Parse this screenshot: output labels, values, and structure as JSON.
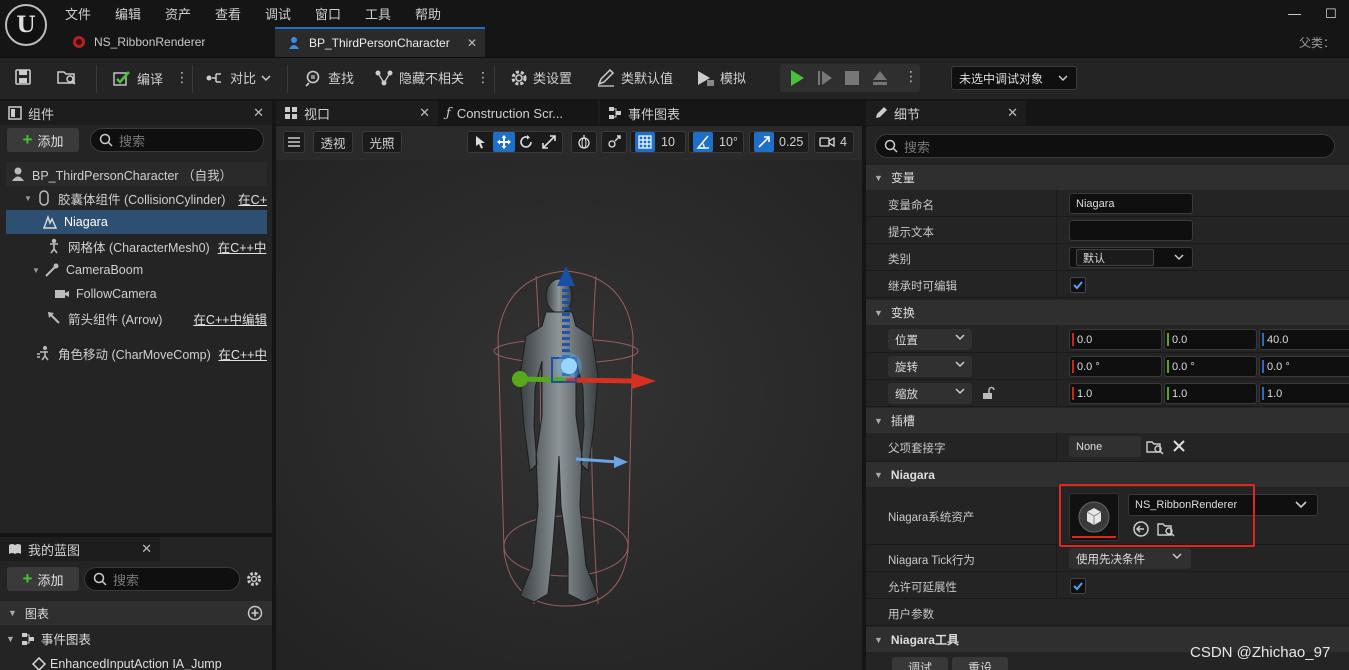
{
  "menu": [
    "文件",
    "编辑",
    "资产",
    "查看",
    "调试",
    "窗口",
    "工具",
    "帮助"
  ],
  "window_controls": {
    "minimize": "—",
    "maximize": "☐"
  },
  "tabs": [
    {
      "label": "NS_RibbonRenderer",
      "active": false
    },
    {
      "label": "BP_ThirdPersonCharacter",
      "active": true
    }
  ],
  "parent_class_label": "父类：",
  "toolbar": {
    "compile": "编译",
    "diff": "对比",
    "find": "查找",
    "hide_unrelated": "隐藏不相关",
    "class_settings": "类设置",
    "class_defaults": "类默认值",
    "simulate": "模拟",
    "debug_object": "未选中调试对象"
  },
  "components_panel": {
    "title": "组件",
    "add_label": "添加",
    "search_placeholder": "搜索",
    "items": [
      {
        "label": "BP_ThirdPersonCharacter （自我）",
        "edit": ""
      },
      {
        "label": "胶囊体组件 (CollisionCylinder)",
        "edit": "在C+"
      },
      {
        "label": "Niagara",
        "edit": ""
      },
      {
        "label": "网格体 (CharacterMesh0)",
        "edit": "在C++中"
      },
      {
        "label": "CameraBoom",
        "edit": ""
      },
      {
        "label": "FollowCamera",
        "edit": ""
      },
      {
        "label": "箭头组件 (Arrow)",
        "edit": "在C++中编辑"
      },
      {
        "label": "角色移动 (CharMoveComp)",
        "edit": "在C++中"
      }
    ]
  },
  "blueprint_panel": {
    "title": "我的蓝图",
    "add_label": "添加",
    "search_placeholder": "搜索",
    "section_graphs": "图表",
    "event_graph": "事件图表",
    "event_item": "EnhancedInputAction IA_Jump"
  },
  "viewport_tabs": {
    "viewport": "视口",
    "construction": "Construction Scr...",
    "event_graph": "事件图表"
  },
  "viewport_toolbar": {
    "perspective": "透视",
    "lighting": "光照",
    "grid_size": "10",
    "rotation_snap": "10°",
    "scale_snap": "0.25",
    "camera_speed": "4"
  },
  "details": {
    "title": "细节",
    "search_placeholder": "搜索",
    "sections": {
      "variable": "变量",
      "transform": "变换",
      "socket": "插槽",
      "niagara": "Niagara",
      "niagara_tools": "Niagara工具"
    },
    "variable_rows": {
      "name_label": "变量命名",
      "name_value": "Niagara",
      "tooltip_label": "提示文本",
      "tooltip_value": "",
      "category_label": "类别",
      "category_value": "默认",
      "inherit_label": "继承时可编辑"
    },
    "transform_rows": {
      "location": "位置",
      "location_values": [
        "0.0",
        "0.0",
        "40.0"
      ],
      "rotation": "旋转",
      "rotation_values": [
        "0.0 °",
        "0.0 °",
        "0.0 °"
      ],
      "scale": "缩放",
      "scale_values": [
        "1.0",
        "1.0",
        "1.0"
      ]
    },
    "socket_rows": {
      "parent_socket_label": "父项套接字",
      "parent_socket_value": "None"
    },
    "niagara_rows": {
      "system_asset_label": "Niagara系统资产",
      "system_asset_value": "NS_RibbonRenderer",
      "tick_behavior_label": "Niagara Tick行为",
      "tick_behavior_value": "使用先决条件",
      "allow_scalability_label": "允许可延展性",
      "user_params_label": "用户参数"
    },
    "tools_buttons": [
      "调试",
      "重设"
    ]
  },
  "watermark": "CSDN @Zhichao_97",
  "colors": {
    "accent_blue": "#1e6fc7",
    "selection": "#2c4f72",
    "play_green": "#4cbf3c",
    "highlight_red": "#e0261f"
  }
}
